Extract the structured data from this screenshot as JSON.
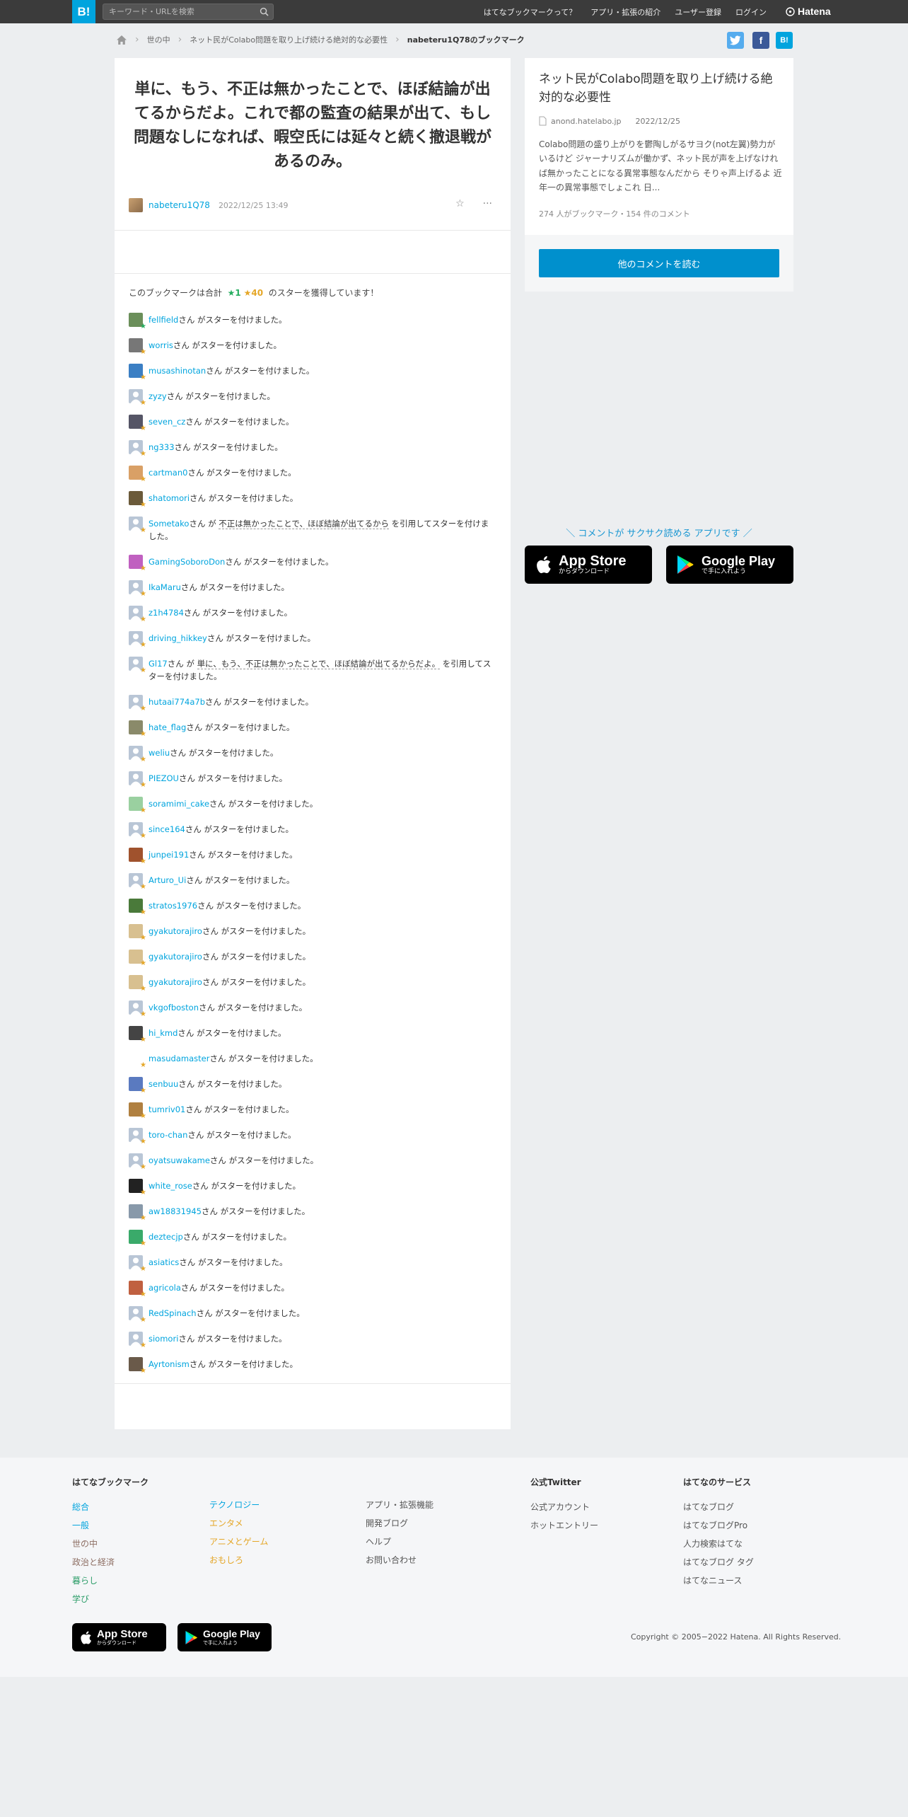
{
  "header": {
    "logo": "B!",
    "search_placeholder": "キーワード・URLを検索",
    "nav": [
      "はてなブックマークって？",
      "アプリ・拡張の紹介",
      "ユーザー登録",
      "ログイン"
    ],
    "brand": "Hatena"
  },
  "breadcrumb": [
    "世の中",
    "ネット民がColabo問題を取り上げ続ける絶対的な必要性",
    "nabeteru1Q78のブックマーク"
  ],
  "share": [
    {
      "icon": "twitter-icon",
      "color": "#55acee",
      "label": "t"
    },
    {
      "icon": "facebook-icon",
      "color": "#3b5998",
      "label": "f"
    },
    {
      "icon": "hatena-bookmark-icon",
      "color": "#00a4de",
      "label": "B!"
    }
  ],
  "main": {
    "comment": "単に、もう、不正は無かったことで、ほぼ結論が出てるからだよ。これで都の監査の結果が出て、もし問題なしになれば、暇空氏には延々と続く撤退戦があるのみ。",
    "user": "nabeteru1Q78",
    "date": "2022/12/25 13:49",
    "summary_prefix": "このブックマークは合計",
    "green_count": "★1",
    "yellow_count": "★40",
    "summary_suffix": "のスターを獲得しています！",
    "star_suffix": "さん がスターを付けました。",
    "quote_mid": "さん が",
    "quote_suffix": "を引用してスターを付けました。",
    "stars": [
      {
        "user": "fellfield",
        "star": "green",
        "avatar": "#6b8f5a"
      },
      {
        "user": "worris",
        "star": "yellow",
        "avatar": "#777"
      },
      {
        "user": "musashinotan",
        "star": "yellow",
        "avatar": "#3b7fc4"
      },
      {
        "user": "zyzy",
        "star": "yellow",
        "avatar": "#b9c6d6"
      },
      {
        "user": "seven_cz",
        "star": "yellow",
        "avatar": "#556"
      },
      {
        "user": "ng333",
        "star": "yellow",
        "avatar": "#b9c6d6"
      },
      {
        "user": "cartman0",
        "star": "yellow",
        "avatar": "#d9a066"
      },
      {
        "user": "shatomori",
        "star": "yellow",
        "avatar": "#6b5a3a"
      },
      {
        "user": "Sometako",
        "star": "yellow",
        "avatar": "#b9c6d6",
        "quote": "不正は無かったことで、ほぼ結論が出てるから"
      },
      {
        "user": "GamingSoboroDon",
        "star": "yellow",
        "avatar": "#c060c0"
      },
      {
        "user": "IkaMaru",
        "star": "yellow",
        "avatar": "#b9c6d6"
      },
      {
        "user": "z1h4784",
        "star": "yellow",
        "avatar": "#b9c6d6"
      },
      {
        "user": "driving_hikkey",
        "star": "yellow",
        "avatar": "#b9c6d6"
      },
      {
        "user": "Gl17",
        "star": "yellow",
        "avatar": "#b9c6d6",
        "quote": "単に、もう、不正は無かったことで、ほぼ結論が出てるからだよ。"
      },
      {
        "user": "hutaai774a7b",
        "star": "yellow",
        "avatar": "#b9c6d6"
      },
      {
        "user": "hate_flag",
        "star": "yellow",
        "avatar": "#8a8a6a"
      },
      {
        "user": "weliu",
        "star": "yellow",
        "avatar": "#b9c6d6"
      },
      {
        "user": "PIEZOU",
        "star": "yellow",
        "avatar": "#b9c6d6"
      },
      {
        "user": "soramimi_cake",
        "star": "yellow",
        "avatar": "#9ad0a0"
      },
      {
        "user": "since164",
        "star": "yellow",
        "avatar": "#b9c6d6"
      },
      {
        "user": "junpei191",
        "star": "yellow",
        "avatar": "#a0522d"
      },
      {
        "user": "Arturo_Ui",
        "star": "yellow",
        "avatar": "#b9c6d6"
      },
      {
        "user": "stratos1976",
        "star": "yellow",
        "avatar": "#4a7a3a"
      },
      {
        "user": "gyakutorajiro",
        "star": "yellow",
        "avatar": "#d8c090"
      },
      {
        "user": "gyakutorajiro",
        "star": "yellow",
        "avatar": "#d8c090"
      },
      {
        "user": "gyakutorajiro",
        "star": "yellow",
        "avatar": "#d8c090"
      },
      {
        "user": "vkgofboston",
        "star": "yellow",
        "avatar": "#b9c6d6"
      },
      {
        "user": "hi_kmd",
        "star": "yellow",
        "avatar": "#444"
      },
      {
        "user": "masudamaster",
        "star": "yellow",
        "avatar": "#ffffff"
      },
      {
        "user": "senbuu",
        "star": "yellow",
        "avatar": "#5a7ac0"
      },
      {
        "user": "tumriv01",
        "star": "yellow",
        "avatar": "#b08040"
      },
      {
        "user": "toro-chan",
        "star": "yellow",
        "avatar": "#b9c6d6"
      },
      {
        "user": "oyatsuwakame",
        "star": "yellow",
        "avatar": "#b9c6d6"
      },
      {
        "user": "white_rose",
        "star": "yellow",
        "avatar": "#222"
      },
      {
        "user": "aw18831945",
        "star": "yellow",
        "avatar": "#8899aa"
      },
      {
        "user": "deztecjp",
        "star": "yellow",
        "avatar": "#3aaa6a"
      },
      {
        "user": "asiatics",
        "star": "yellow",
        "avatar": "#b9c6d6"
      },
      {
        "user": "agricola",
        "star": "yellow",
        "avatar": "#c06040"
      },
      {
        "user": "RedSpinach",
        "star": "yellow",
        "avatar": "#b9c6d6"
      },
      {
        "user": "siomori",
        "star": "yellow",
        "avatar": "#b9c6d6"
      },
      {
        "user": "Ayrtonism",
        "star": "yellow",
        "avatar": "#6a5a4a"
      }
    ]
  },
  "entry": {
    "title": "ネット民がColabo問題を取り上げ続ける絶対的な必要性",
    "domain": "anond.hatelabo.jp",
    "date": "2022/12/25",
    "excerpt": "Colabo問題の盛り上がりを鬱陶しがるサヨク(not左翼)勢力がいるけど ジャーナリズムが働かず、ネット民が声を上げなければ無かったことになる異常事態なんだから そりゃ声上げるよ 近年一の異常事態でしょこれ 日...",
    "stats": "274 人がブックマーク・154 件のコメント",
    "button": "他のコメントを読む"
  },
  "promo": {
    "text": "＼ コメントが サクサク読める アプリです ／",
    "appstore_small": "からダウンロード",
    "appstore_big": "App Store",
    "googleplay_big": "Google Play",
    "googleplay_small": "で手に入れよう"
  },
  "footer": {
    "col1_title": "はてなブックマーク",
    "col1": [
      {
        "label": "総合",
        "color": "#00a4de"
      },
      {
        "label": "一般",
        "color": "#00a4de"
      },
      {
        "label": "世の中",
        "color": "#8d6e63"
      },
      {
        "label": "政治と経済",
        "color": "#8d6e63"
      },
      {
        "label": "暮らし",
        "color": "#2e9e6a"
      },
      {
        "label": "学び",
        "color": "#2e9e6a"
      }
    ],
    "col2": [
      {
        "label": "テクノロジー",
        "color": "#00a4de"
      },
      {
        "label": "エンタメ",
        "color": "#e5a728"
      },
      {
        "label": "アニメとゲーム",
        "color": "#e5a728"
      },
      {
        "label": "おもしろ",
        "color": "#e5a728"
      }
    ],
    "col3": [
      "アプリ・拡張機能",
      "開発ブログ",
      "ヘルプ",
      "お問い合わせ"
    ],
    "col4_title": "公式Twitter",
    "col4": [
      "公式アカウント",
      "ホットエントリー"
    ],
    "col5_title": "はてなのサービス",
    "col5": [
      "はてなブログ",
      "はてなブログPro",
      "人力検索はてな",
      "はてなブログ タグ",
      "はてなニュース"
    ],
    "copyright": "Copyright © 2005−2022 Hatena. All Rights Reserved."
  }
}
